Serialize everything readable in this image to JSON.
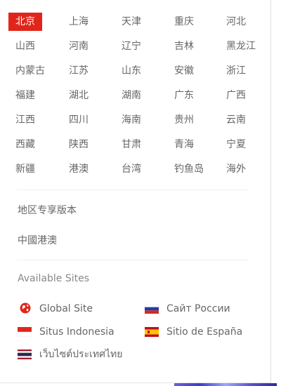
{
  "regions": [
    [
      "北京",
      "上海",
      "天津",
      "重庆",
      "河北"
    ],
    [
      "山西",
      "河南",
      "辽宁",
      "吉林",
      "黑龙江"
    ],
    [
      "内蒙古",
      "江苏",
      "山东",
      "安徽",
      "浙江"
    ],
    [
      "福建",
      "湖北",
      "湖南",
      "广东",
      "广西"
    ],
    [
      "江西",
      "四川",
      "海南",
      "贵州",
      "云南"
    ],
    [
      "西藏",
      "陕西",
      "甘肃",
      "青海",
      "宁夏"
    ],
    [
      "新疆",
      "港澳",
      "台湾",
      "钓鱼岛",
      "海外"
    ]
  ],
  "selected_region": "北京",
  "links": {
    "regional_edition": "地区专享版本",
    "hk_macau": "中國港澳"
  },
  "available_sites": {
    "title": "Available Sites",
    "sites": [
      {
        "label": "Global Site",
        "icon": "globe-icon"
      },
      {
        "label": "Сайт России",
        "icon": "russia-flag-icon"
      },
      {
        "label": "Situs Indonesia",
        "icon": "indonesia-flag-icon"
      },
      {
        "label": "Sitio de España",
        "icon": "spain-flag-icon"
      },
      {
        "label": "เว็บไซต์ประเทศไทย",
        "icon": "thailand-flag-icon"
      }
    ]
  },
  "colors": {
    "accent": "#e1251b",
    "text": "#666666"
  }
}
